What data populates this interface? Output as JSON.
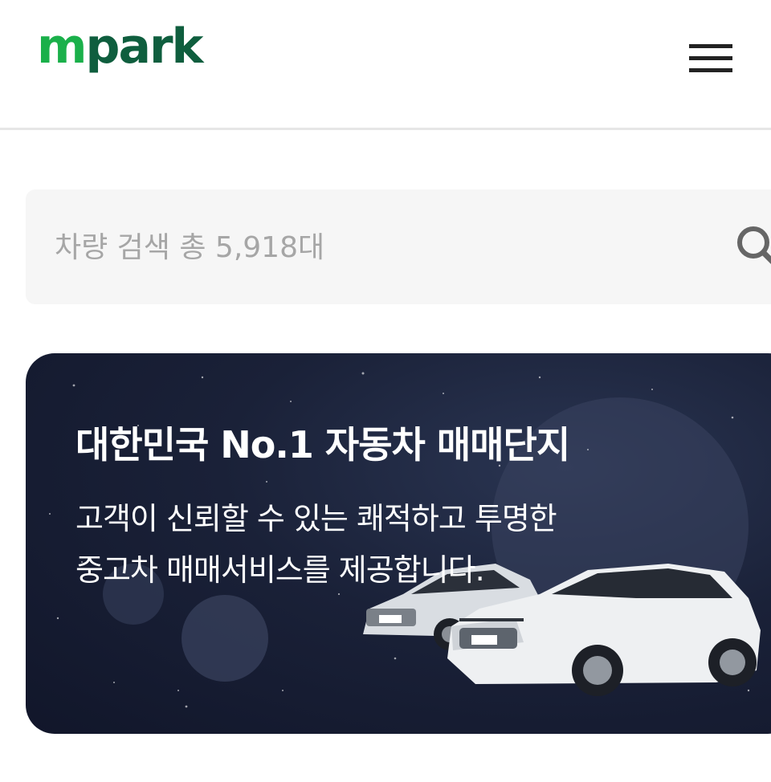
{
  "header": {
    "logo_prefix": "m",
    "logo_rest": "park",
    "menu_icon": "hamburger-menu-icon"
  },
  "search": {
    "placeholder": "차량 검색 총 5,918대",
    "icon": "search-icon"
  },
  "banner": {
    "title": "대한민국 No.1 자동차 매매단지",
    "desc_line1": "고객이 신뢰할 수 있는 쾌적하고 투명한",
    "desc_line2": "중고차 매매서비스를 제공합니다.",
    "car_plate": "mpark"
  },
  "colors": {
    "logo_green": "#1ab04a",
    "logo_dark_green": "#0f5e3e",
    "banner_bg": "#1a2138",
    "search_bg": "#f6f6f6"
  }
}
